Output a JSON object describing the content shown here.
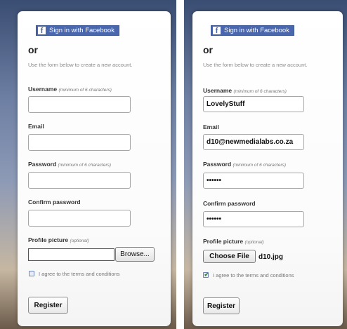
{
  "common": {
    "facebook_label": "Sign in with Facebook",
    "facebook_icon": "f",
    "or": "or",
    "intro": "Use the form below to create a new account.",
    "username_label": "Username",
    "username_hint": "(minimum of 6 characters)",
    "email_label": "Email",
    "password_label": "Password",
    "password_hint": "(minimum of 6 characters)",
    "confirm_label": "Confirm password",
    "picture_label": "Profile picture",
    "picture_hint": "(optional)",
    "agree_label": "I agree to the terms and conditions",
    "register_label": "Register",
    "accent_color": "#4a67ad"
  },
  "left_form": {
    "username_value": "",
    "email_value": "",
    "password_value": "",
    "confirm_value": "",
    "browse_label": "Browse...",
    "agree_checked": false
  },
  "right_form": {
    "username_value": "LovelyStuff",
    "email_value": "d10@newmedialabs.co.za",
    "password_value": "••••••",
    "confirm_value": "••••••",
    "choose_file_label": "Choose File",
    "file_name": "d10.jpg",
    "agree_checked": true,
    "check_mark": "✔"
  }
}
